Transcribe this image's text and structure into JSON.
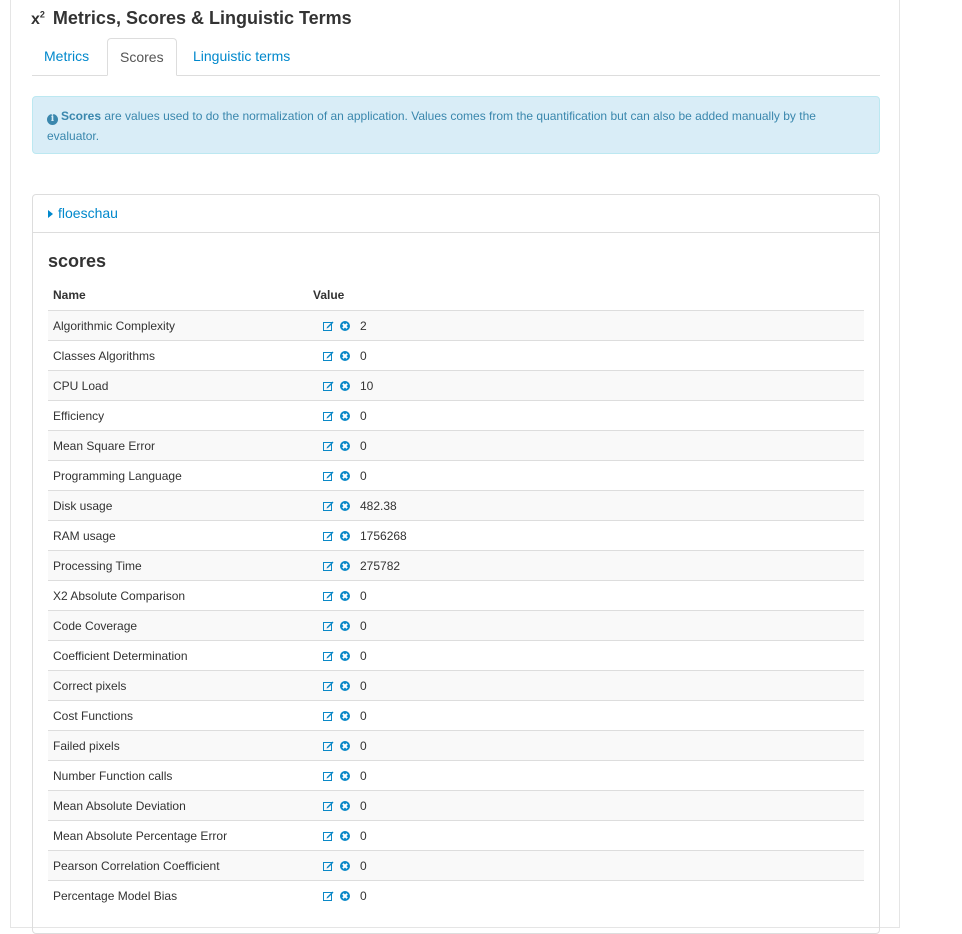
{
  "page": {
    "title_icon": "x",
    "title_icon_sup": "2",
    "title": "Metrics, Scores & Linguistic Terms"
  },
  "tabs": [
    {
      "label": "Metrics",
      "active": false
    },
    {
      "label": "Scores",
      "active": true
    },
    {
      "label": "Linguistic terms",
      "active": false
    }
  ],
  "info": {
    "icon": "info-icon",
    "bold": "Scores",
    "text": " are values used to do the normalization of an application. Values comes from the quantification but can also be added manually by the evaluator."
  },
  "panel": {
    "header": "floeschau",
    "section_title": "scores",
    "columns": {
      "name": "Name",
      "value": "Value"
    },
    "rows": [
      {
        "name": "Algorithmic Complexity",
        "value": "2"
      },
      {
        "name": "Classes Algorithms",
        "value": "0"
      },
      {
        "name": "CPU Load",
        "value": "10"
      },
      {
        "name": "Efficiency",
        "value": "0"
      },
      {
        "name": "Mean Square Error",
        "value": "0"
      },
      {
        "name": "Programming Language",
        "value": "0"
      },
      {
        "name": "Disk usage",
        "value": "482.38"
      },
      {
        "name": "RAM usage",
        "value": "1756268"
      },
      {
        "name": "Processing Time",
        "value": "275782"
      },
      {
        "name": "X2 Absolute Comparison",
        "value": "0"
      },
      {
        "name": "Code Coverage",
        "value": "0"
      },
      {
        "name": "Coefficient Determination",
        "value": "0"
      },
      {
        "name": "Correct pixels",
        "value": "0"
      },
      {
        "name": "Cost Functions",
        "value": "0"
      },
      {
        "name": "Failed pixels",
        "value": "0"
      },
      {
        "name": "Number Function calls",
        "value": "0"
      },
      {
        "name": "Mean Absolute Deviation",
        "value": "0"
      },
      {
        "name": "Mean Absolute Percentage Error",
        "value": "0"
      },
      {
        "name": "Pearson Correlation Coefficient",
        "value": "0"
      },
      {
        "name": "Percentage Model Bias",
        "value": "0"
      }
    ]
  },
  "colors": {
    "link": "#0088cc",
    "info_bg": "#d9edf7",
    "info_text": "#3a87ad"
  }
}
